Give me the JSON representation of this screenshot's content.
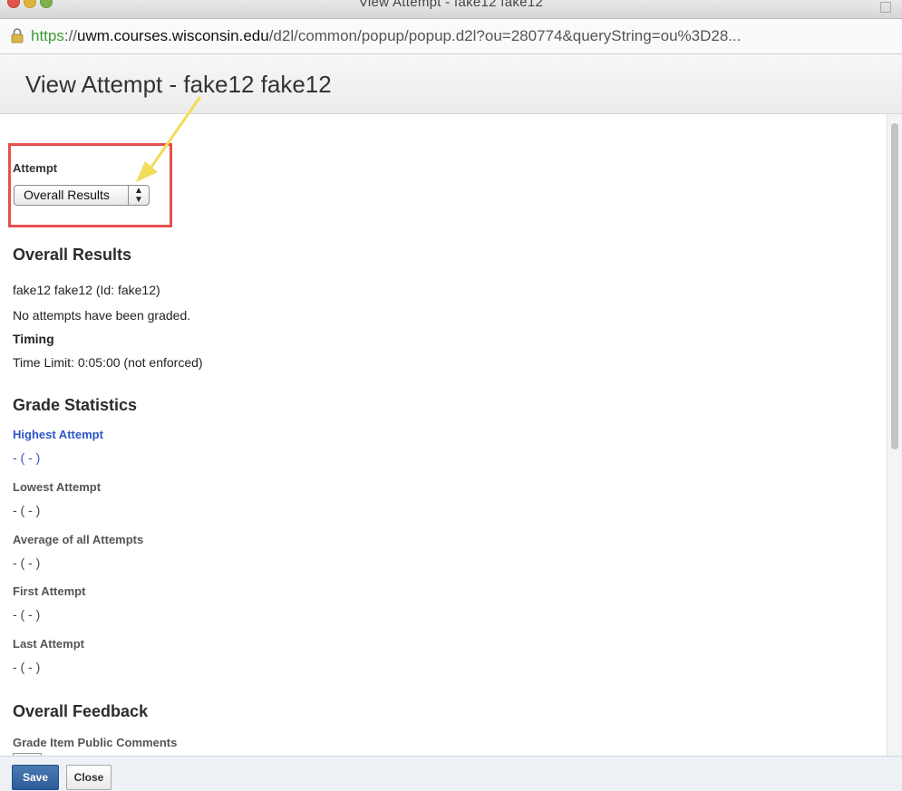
{
  "window": {
    "title": "View Attempt - fake12 fake12"
  },
  "browser": {
    "url_scheme": "https",
    "url_separator": "://",
    "url_domain": "uwm.courses.wisconsin.edu",
    "url_path": "/d2l/common/popup/popup.d2l?ou=280774&queryString=ou%3D28..."
  },
  "page": {
    "title": "View Attempt - fake12 fake12"
  },
  "attempt": {
    "label": "Attempt",
    "selected": "Overall Results",
    "arrows": "▲▼"
  },
  "overall_results": {
    "heading": "Overall Results",
    "user_line": "fake12 fake12 (Id: fake12)",
    "status": "No attempts have been graded.",
    "timing_label": "Timing",
    "time_limit": "Time Limit: 0:05:00 (not enforced)"
  },
  "grade_statistics": {
    "heading": "Grade Statistics",
    "items": [
      {
        "label": "Highest Attempt",
        "value": "- ( - )"
      },
      {
        "label": "Lowest Attempt",
        "value": "- ( - )"
      },
      {
        "label": "Average of all Attempts",
        "value": "- ( - )"
      },
      {
        "label": "First Attempt",
        "value": "- ( - )"
      },
      {
        "label": "Last Attempt",
        "value": "- ( - )"
      }
    ]
  },
  "overall_feedback": {
    "heading": "Overall Feedback",
    "comments_label": "Grade Item Public Comments"
  },
  "footer": {
    "save_label": "Save",
    "close_label": "Close"
  },
  "colors": {
    "highlight": "#e6504f",
    "annotation_arrow": "#f2dc58",
    "link": "#2f56c8",
    "primary_button": "#2d5c99"
  }
}
